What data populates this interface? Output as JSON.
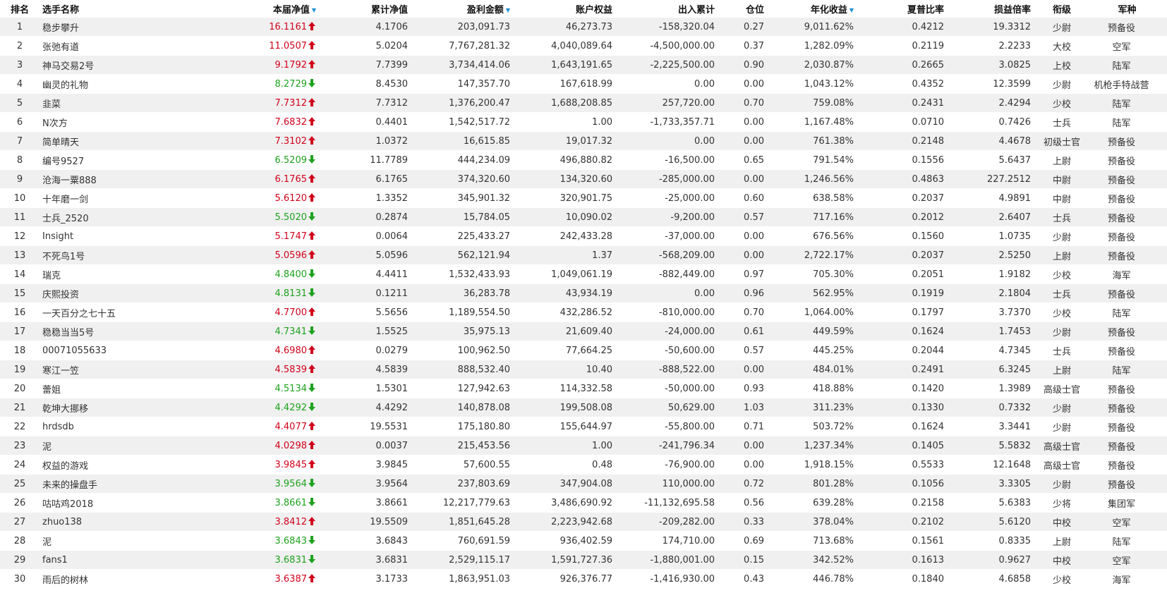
{
  "colors": {
    "up": "#d0021b",
    "down": "#1fa21f",
    "sort_indicator": "#1a8fd6",
    "row_stripe": "#f0f0f0"
  },
  "headers": {
    "rank": "排名",
    "name": "选手名称",
    "weekly_nav": "本届净值",
    "cum_nav": "累计净值",
    "profit": "盈利金额",
    "equity": "账户权益",
    "io": "出入累计",
    "position": "仓位",
    "annual": "年化收益",
    "sharpe": "夏普比率",
    "pl_ratio": "损益倍率",
    "rank_title": "衔级",
    "branch": "军种"
  },
  "sorted_columns": [
    "weekly_nav",
    "profit",
    "annual"
  ],
  "rows": [
    {
      "rank": "1",
      "name": "稳步攀升",
      "weekly_nav": "16.1161",
      "trend": "up",
      "cum_nav": "4.1706",
      "profit": "203,091.73",
      "equity": "46,273.73",
      "io": "-158,320.04",
      "position": "0.27",
      "annual": "9,011.62%",
      "sharpe": "0.4212",
      "pl_ratio": "19.3312",
      "title": "少尉",
      "branch": "预备役"
    },
    {
      "rank": "2",
      "name": "张弛有道",
      "weekly_nav": "11.0507",
      "trend": "up",
      "cum_nav": "5.0204",
      "profit": "7,767,281.32",
      "equity": "4,040,089.64",
      "io": "-4,500,000.00",
      "position": "0.37",
      "annual": "1,282.09%",
      "sharpe": "0.2119",
      "pl_ratio": "2.2233",
      "title": "大校",
      "branch": "空军"
    },
    {
      "rank": "3",
      "name": "神马交易2号",
      "weekly_nav": "9.1792",
      "trend": "up",
      "cum_nav": "7.7399",
      "profit": "3,734,414.06",
      "equity": "1,643,191.65",
      "io": "-2,225,500.00",
      "position": "0.90",
      "annual": "2,030.87%",
      "sharpe": "0.2665",
      "pl_ratio": "3.0825",
      "title": "上校",
      "branch": "陆军"
    },
    {
      "rank": "4",
      "name": "幽灵的礼物",
      "weekly_nav": "8.2729",
      "trend": "down",
      "cum_nav": "8.4530",
      "profit": "147,357.70",
      "equity": "167,618.99",
      "io": "0.00",
      "position": "0.00",
      "annual": "1,043.12%",
      "sharpe": "0.4352",
      "pl_ratio": "12.3599",
      "title": "少尉",
      "branch": "机枪手特战营"
    },
    {
      "rank": "5",
      "name": "韭菜",
      "weekly_nav": "7.7312",
      "trend": "up",
      "cum_nav": "7.7312",
      "profit": "1,376,200.47",
      "equity": "1,688,208.85",
      "io": "257,720.00",
      "position": "0.70",
      "annual": "759.08%",
      "sharpe": "0.2431",
      "pl_ratio": "2.4294",
      "title": "少校",
      "branch": "陆军"
    },
    {
      "rank": "6",
      "name": "N次方",
      "weekly_nav": "7.6832",
      "trend": "up",
      "cum_nav": "0.4401",
      "profit": "1,542,517.72",
      "equity": "1.00",
      "io": "-1,733,357.71",
      "position": "0.00",
      "annual": "1,167.48%",
      "sharpe": "0.0710",
      "pl_ratio": "0.7426",
      "title": "士兵",
      "branch": "陆军"
    },
    {
      "rank": "7",
      "name": "简单晴天",
      "weekly_nav": "7.3102",
      "trend": "up",
      "cum_nav": "1.0372",
      "profit": "16,615.85",
      "equity": "19,017.32",
      "io": "0.00",
      "position": "0.00",
      "annual": "761.38%",
      "sharpe": "0.2148",
      "pl_ratio": "4.4678",
      "title": "初级士官",
      "branch": "预备役"
    },
    {
      "rank": "8",
      "name": "编号9527",
      "weekly_nav": "6.5209",
      "trend": "down",
      "cum_nav": "11.7789",
      "profit": "444,234.09",
      "equity": "496,880.82",
      "io": "-16,500.00",
      "position": "0.65",
      "annual": "791.54%",
      "sharpe": "0.1556",
      "pl_ratio": "5.6437",
      "title": "上尉",
      "branch": "预备役"
    },
    {
      "rank": "9",
      "name": "沧海一粟888",
      "weekly_nav": "6.1765",
      "trend": "up",
      "cum_nav": "6.1765",
      "profit": "374,320.60",
      "equity": "134,320.60",
      "io": "-285,000.00",
      "position": "0.00",
      "annual": "1,246.56%",
      "sharpe": "0.4863",
      "pl_ratio": "227.2512",
      "title": "中尉",
      "branch": "预备役"
    },
    {
      "rank": "10",
      "name": "十年磨一剑",
      "weekly_nav": "5.6120",
      "trend": "up",
      "cum_nav": "1.3352",
      "profit": "345,901.32",
      "equity": "320,901.75",
      "io": "-25,000.00",
      "position": "0.60",
      "annual": "638.58%",
      "sharpe": "0.2037",
      "pl_ratio": "4.9891",
      "title": "中尉",
      "branch": "预备役"
    },
    {
      "rank": "11",
      "name": "士兵_2520",
      "weekly_nav": "5.5020",
      "trend": "down",
      "cum_nav": "0.2874",
      "profit": "15,784.05",
      "equity": "10,090.02",
      "io": "-9,200.00",
      "position": "0.57",
      "annual": "717.16%",
      "sharpe": "0.2012",
      "pl_ratio": "2.6407",
      "title": "士兵",
      "branch": "预备役"
    },
    {
      "rank": "12",
      "name": "Insight",
      "weekly_nav": "5.1747",
      "trend": "up",
      "cum_nav": "0.0064",
      "profit": "225,433.27",
      "equity": "242,433.28",
      "io": "-37,000.00",
      "position": "0.00",
      "annual": "676.56%",
      "sharpe": "0.1560",
      "pl_ratio": "1.0735",
      "title": "少尉",
      "branch": "预备役"
    },
    {
      "rank": "13",
      "name": "不死鸟1号",
      "weekly_nav": "5.0596",
      "trend": "up",
      "cum_nav": "5.0596",
      "profit": "562,121.94",
      "equity": "1.37",
      "io": "-568,209.00",
      "position": "0.00",
      "annual": "2,722.17%",
      "sharpe": "0.2037",
      "pl_ratio": "2.5250",
      "title": "上尉",
      "branch": "预备役"
    },
    {
      "rank": "14",
      "name": "瑞克",
      "weekly_nav": "4.8400",
      "trend": "down",
      "cum_nav": "4.4411",
      "profit": "1,532,433.93",
      "equity": "1,049,061.19",
      "io": "-882,449.00",
      "position": "0.97",
      "annual": "705.30%",
      "sharpe": "0.2051",
      "pl_ratio": "1.9182",
      "title": "少校",
      "branch": "海军"
    },
    {
      "rank": "15",
      "name": "庆熙投资",
      "weekly_nav": "4.8131",
      "trend": "down",
      "cum_nav": "0.1211",
      "profit": "36,283.78",
      "equity": "43,934.19",
      "io": "0.00",
      "position": "0.96",
      "annual": "562.95%",
      "sharpe": "0.1919",
      "pl_ratio": "2.1804",
      "title": "士兵",
      "branch": "预备役"
    },
    {
      "rank": "16",
      "name": "一天百分之七十五",
      "weekly_nav": "4.7700",
      "trend": "up",
      "cum_nav": "5.5656",
      "profit": "1,189,554.50",
      "equity": "432,286.52",
      "io": "-810,000.00",
      "position": "0.70",
      "annual": "1,064.00%",
      "sharpe": "0.1797",
      "pl_ratio": "3.7370",
      "title": "少校",
      "branch": "陆军"
    },
    {
      "rank": "17",
      "name": "稳稳当当5号",
      "weekly_nav": "4.7341",
      "trend": "down",
      "cum_nav": "1.5525",
      "profit": "35,975.13",
      "equity": "21,609.40",
      "io": "-24,000.00",
      "position": "0.61",
      "annual": "449.59%",
      "sharpe": "0.1624",
      "pl_ratio": "1.7453",
      "title": "少尉",
      "branch": "预备役"
    },
    {
      "rank": "18",
      "name": "00071055633",
      "weekly_nav": "4.6980",
      "trend": "up",
      "cum_nav": "0.0279",
      "profit": "100,962.50",
      "equity": "77,664.25",
      "io": "-50,600.00",
      "position": "0.57",
      "annual": "445.25%",
      "sharpe": "0.2044",
      "pl_ratio": "4.7345",
      "title": "士兵",
      "branch": "预备役"
    },
    {
      "rank": "19",
      "name": "寒江一笠",
      "weekly_nav": "4.5839",
      "trend": "up",
      "cum_nav": "4.5839",
      "profit": "888,532.40",
      "equity": "10.40",
      "io": "-888,522.00",
      "position": "0.00",
      "annual": "484.01%",
      "sharpe": "0.2491",
      "pl_ratio": "6.3245",
      "title": "上尉",
      "branch": "陆军"
    },
    {
      "rank": "20",
      "name": "蕾姐",
      "weekly_nav": "4.5134",
      "trend": "down",
      "cum_nav": "1.5301",
      "profit": "127,942.63",
      "equity": "114,332.58",
      "io": "-50,000.00",
      "position": "0.93",
      "annual": "418.88%",
      "sharpe": "0.1420",
      "pl_ratio": "1.3989",
      "title": "高级士官",
      "branch": "预备役"
    },
    {
      "rank": "21",
      "name": "乾坤大挪移",
      "weekly_nav": "4.4292",
      "trend": "down",
      "cum_nav": "4.4292",
      "profit": "140,878.08",
      "equity": "199,508.08",
      "io": "50,629.00",
      "position": "1.03",
      "annual": "311.23%",
      "sharpe": "0.1330",
      "pl_ratio": "0.7332",
      "title": "少尉",
      "branch": "预备役"
    },
    {
      "rank": "22",
      "name": "hrdsdb",
      "weekly_nav": "4.4077",
      "trend": "up",
      "cum_nav": "19.5531",
      "profit": "175,180.80",
      "equity": "155,644.97",
      "io": "-55,800.00",
      "position": "0.71",
      "annual": "503.72%",
      "sharpe": "0.1624",
      "pl_ratio": "3.3441",
      "title": "少尉",
      "branch": "预备役"
    },
    {
      "rank": "23",
      "name": "泥",
      "weekly_nav": "4.0298",
      "trend": "up",
      "cum_nav": "0.0037",
      "profit": "215,453.56",
      "equity": "1.00",
      "io": "-241,796.34",
      "position": "0.00",
      "annual": "1,237.34%",
      "sharpe": "0.1405",
      "pl_ratio": "5.5832",
      "title": "高级士官",
      "branch": "预备役"
    },
    {
      "rank": "24",
      "name": "权益的游戏",
      "weekly_nav": "3.9845",
      "trend": "up",
      "cum_nav": "3.9845",
      "profit": "57,600.55",
      "equity": "0.48",
      "io": "-76,900.00",
      "position": "0.00",
      "annual": "1,918.15%",
      "sharpe": "0.5533",
      "pl_ratio": "12.1648",
      "title": "高级士官",
      "branch": "预备役"
    },
    {
      "rank": "25",
      "name": "未来的操盘手",
      "weekly_nav": "3.9564",
      "trend": "down",
      "cum_nav": "3.9564",
      "profit": "237,803.69",
      "equity": "347,904.08",
      "io": "110,000.00",
      "position": "0.72",
      "annual": "801.28%",
      "sharpe": "0.1056",
      "pl_ratio": "3.3305",
      "title": "少尉",
      "branch": "预备役"
    },
    {
      "rank": "26",
      "name": "咕咕鸡2018",
      "weekly_nav": "3.8661",
      "trend": "down",
      "cum_nav": "3.8661",
      "profit": "12,217,779.63",
      "equity": "3,486,690.92",
      "io": "-11,132,695.58",
      "position": "0.56",
      "annual": "639.28%",
      "sharpe": "0.2158",
      "pl_ratio": "5.6383",
      "title": "少将",
      "branch": "集团军"
    },
    {
      "rank": "27",
      "name": "zhuo138",
      "weekly_nav": "3.8412",
      "trend": "up",
      "cum_nav": "19.5509",
      "profit": "1,851,645.28",
      "equity": "2,223,942.68",
      "io": "-209,282.00",
      "position": "0.33",
      "annual": "378.04%",
      "sharpe": "0.2102",
      "pl_ratio": "5.6120",
      "title": "中校",
      "branch": "空军"
    },
    {
      "rank": "28",
      "name": "泥",
      "weekly_nav": "3.6843",
      "trend": "down",
      "cum_nav": "3.6843",
      "profit": "760,691.59",
      "equity": "936,402.59",
      "io": "174,710.00",
      "position": "0.69",
      "annual": "713.68%",
      "sharpe": "0.1561",
      "pl_ratio": "0.8335",
      "title": "上尉",
      "branch": "陆军"
    },
    {
      "rank": "29",
      "name": "fans1",
      "weekly_nav": "3.6831",
      "trend": "down",
      "cum_nav": "3.6831",
      "profit": "2,529,115.17",
      "equity": "1,591,727.36",
      "io": "-1,880,001.00",
      "position": "0.15",
      "annual": "342.52%",
      "sharpe": "0.1613",
      "pl_ratio": "0.9627",
      "title": "中校",
      "branch": "空军"
    },
    {
      "rank": "30",
      "name": "雨后的树林",
      "weekly_nav": "3.6387",
      "trend": "up",
      "cum_nav": "3.1733",
      "profit": "1,863,951.03",
      "equity": "926,376.77",
      "io": "-1,416,930.00",
      "position": "0.43",
      "annual": "446.78%",
      "sharpe": "0.1840",
      "pl_ratio": "4.6858",
      "title": "少校",
      "branch": "海军"
    }
  ]
}
